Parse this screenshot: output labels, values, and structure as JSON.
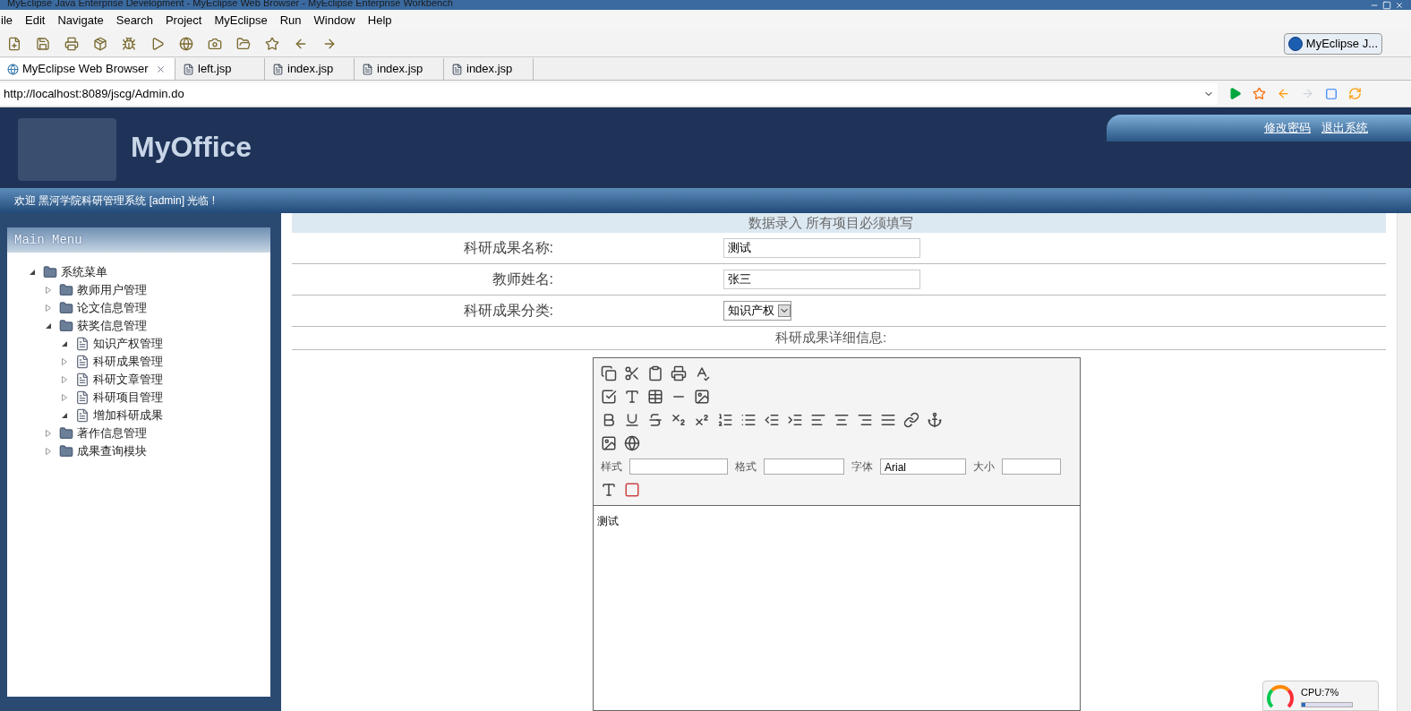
{
  "window": {
    "title": "MyEclipse Java Enterprise Development - MyEclipse Web Browser - MyEclipse Enterprise Workbench"
  },
  "menu": [
    "ile",
    "Edit",
    "Navigate",
    "Search",
    "Project",
    "MyEclipse",
    "Run",
    "Window",
    "Help"
  ],
  "perspective": {
    "label": "MyEclipse J..."
  },
  "tabs": [
    {
      "label": "MyEclipse Web Browser",
      "selected": true,
      "kind": "browser"
    },
    {
      "label": "left.jsp",
      "selected": false,
      "kind": "jsp"
    },
    {
      "label": "index.jsp",
      "selected": false,
      "kind": "jsp"
    },
    {
      "label": "index.jsp",
      "selected": false,
      "kind": "jsp"
    },
    {
      "label": "index.jsp",
      "selected": false,
      "kind": "jsp"
    }
  ],
  "address": {
    "value": "http://localhost:8089/jscg/Admin.do"
  },
  "page": {
    "logo": "MyOffice",
    "links": [
      "修改密码",
      "退出系统"
    ],
    "welcome": "欢迎 黑河学院科研管理系统 [admin] 光临 !",
    "menu_title": "Main Menu",
    "tree": [
      {
        "label": "系统菜单",
        "kind": "folder",
        "expanded": true,
        "children": [
          {
            "label": "教师用户管理",
            "kind": "folder",
            "expanded": false
          },
          {
            "label": "论文信息管理",
            "kind": "folder",
            "expanded": false
          },
          {
            "label": "获奖信息管理",
            "kind": "folder",
            "expanded": true,
            "children": [
              {
                "label": "知识产权管理",
                "kind": "page",
                "expanded": true
              },
              {
                "label": "科研成果管理",
                "kind": "page",
                "expanded": false
              },
              {
                "label": "科研文章管理",
                "kind": "page",
                "expanded": false
              },
              {
                "label": "科研项目管理",
                "kind": "page",
                "expanded": false
              },
              {
                "label": "增加科研成果",
                "kind": "page",
                "expanded": true
              }
            ]
          },
          {
            "label": "著作信息管理",
            "kind": "folder",
            "expanded": false
          },
          {
            "label": "成果查询模块",
            "kind": "folder",
            "expanded": false
          }
        ]
      }
    ],
    "form_title": "数据录入 所有项目必须填写",
    "fields": [
      {
        "label": "科研成果名称:",
        "kind": "text",
        "value": "测试"
      },
      {
        "label": "教师姓名:",
        "kind": "text",
        "value": "张三"
      },
      {
        "label": "科研成果分类:",
        "kind": "select",
        "value": "知识产权"
      }
    ],
    "detail_label": "科研成果详细信息:",
    "editor": {
      "style_label": "样式",
      "format_label": "格式",
      "font_label": "字体",
      "font_value": "Arial",
      "size_label": "大小",
      "content": "测试"
    }
  },
  "cpu": {
    "reading": "CPU:7%",
    "level": 0.07
  }
}
